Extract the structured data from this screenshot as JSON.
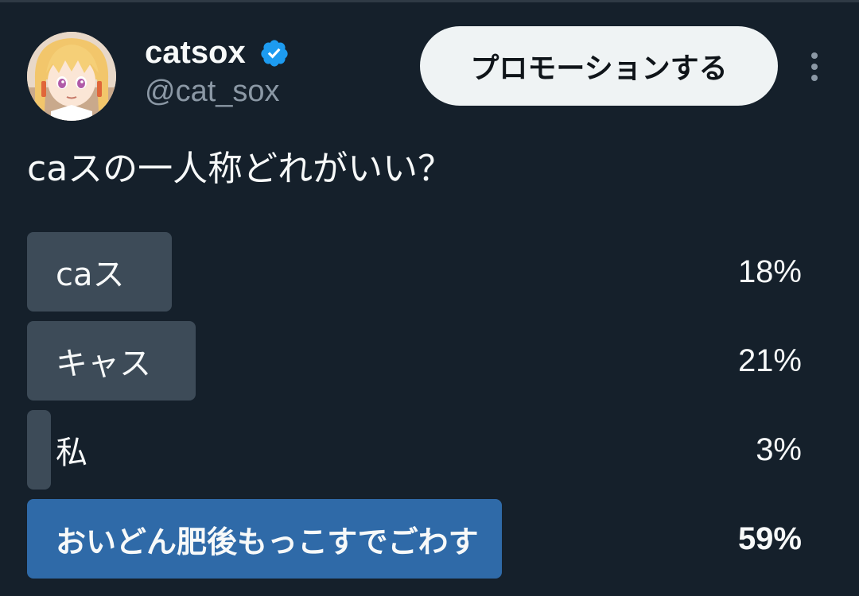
{
  "colors": {
    "background": "#15202b",
    "text_primary": "#f7f9f9",
    "text_secondary": "#8b98a5",
    "verified_badge": "#1d9bf0",
    "poll_bar": "#3d4b58",
    "poll_bar_winner": "#2f6aa8",
    "promote_button_bg": "#eff3f4"
  },
  "author": {
    "display_name": "catsox",
    "handle": "@cat_sox",
    "verified": true,
    "avatar_icon": "avatar-anime-girl"
  },
  "header": {
    "promote_label": "プロモーションする",
    "more_icon": "more-vertical-icon"
  },
  "tweet": {
    "text": "caスの一人称どれがいい？"
  },
  "poll": {
    "options": [
      {
        "label": "caス",
        "percent_text": "18%",
        "percent": 18,
        "winner": false
      },
      {
        "label": "キャス",
        "percent_text": "21%",
        "percent": 21,
        "winner": false
      },
      {
        "label": "私",
        "percent_text": "3%",
        "percent": 3,
        "winner": false
      },
      {
        "label": "おいどん肥後もっこすでごわす",
        "percent_text": "59%",
        "percent": 59,
        "winner": true
      }
    ]
  }
}
